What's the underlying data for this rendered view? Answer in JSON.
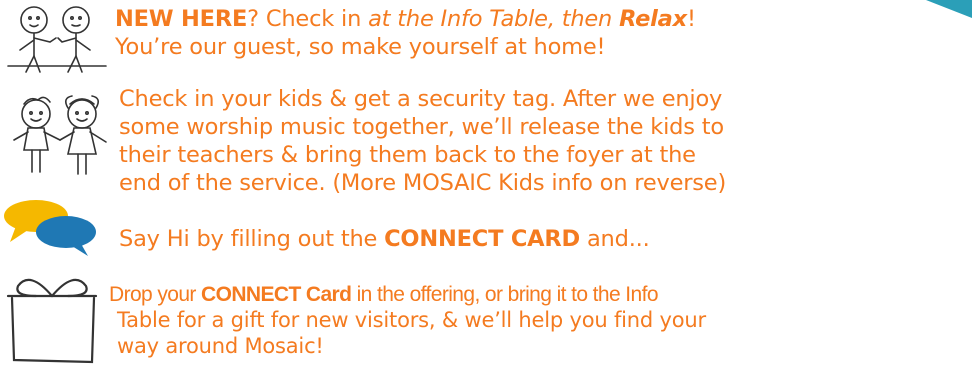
{
  "colors": {
    "text": "#f47b20",
    "accent_teal": "#2b9fb8",
    "bubble_yellow": "#f5b800",
    "bubble_blue": "#1f78b4"
  },
  "section1": {
    "icon": "two-people-talking-icon",
    "bold1": "NEW HERE",
    "part1": "? Check in ",
    "italic1": "at the Info Table, then ",
    "bold2": "Relax",
    "part2": "!",
    "line2": "You’re our guest, so make yourself at home!"
  },
  "section2": {
    "icon": "kids-holding-hands-icon",
    "lines": [
      "Check in your kids & get a security tag.  After we enjoy",
      "some worship music together, we’ll release the kids to",
      "their teachers & bring them back to the foyer at the",
      "end of the service. (More MOSAIC Kids info on reverse)"
    ]
  },
  "section3": {
    "icon": "speech-bubbles-icon",
    "before": "Say Hi by filling out the ",
    "bold": "CONNECT CARD",
    "after": " and..."
  },
  "section4": {
    "icon": "gift-box-icon",
    "before": "Drop your ",
    "bold": "CONNECT Card",
    "after": " in the offering, or bring it to the Info",
    "line2": "Table for a gift for new visitors, & we’ll help you find your",
    "line3": "way around Mosaic!"
  }
}
